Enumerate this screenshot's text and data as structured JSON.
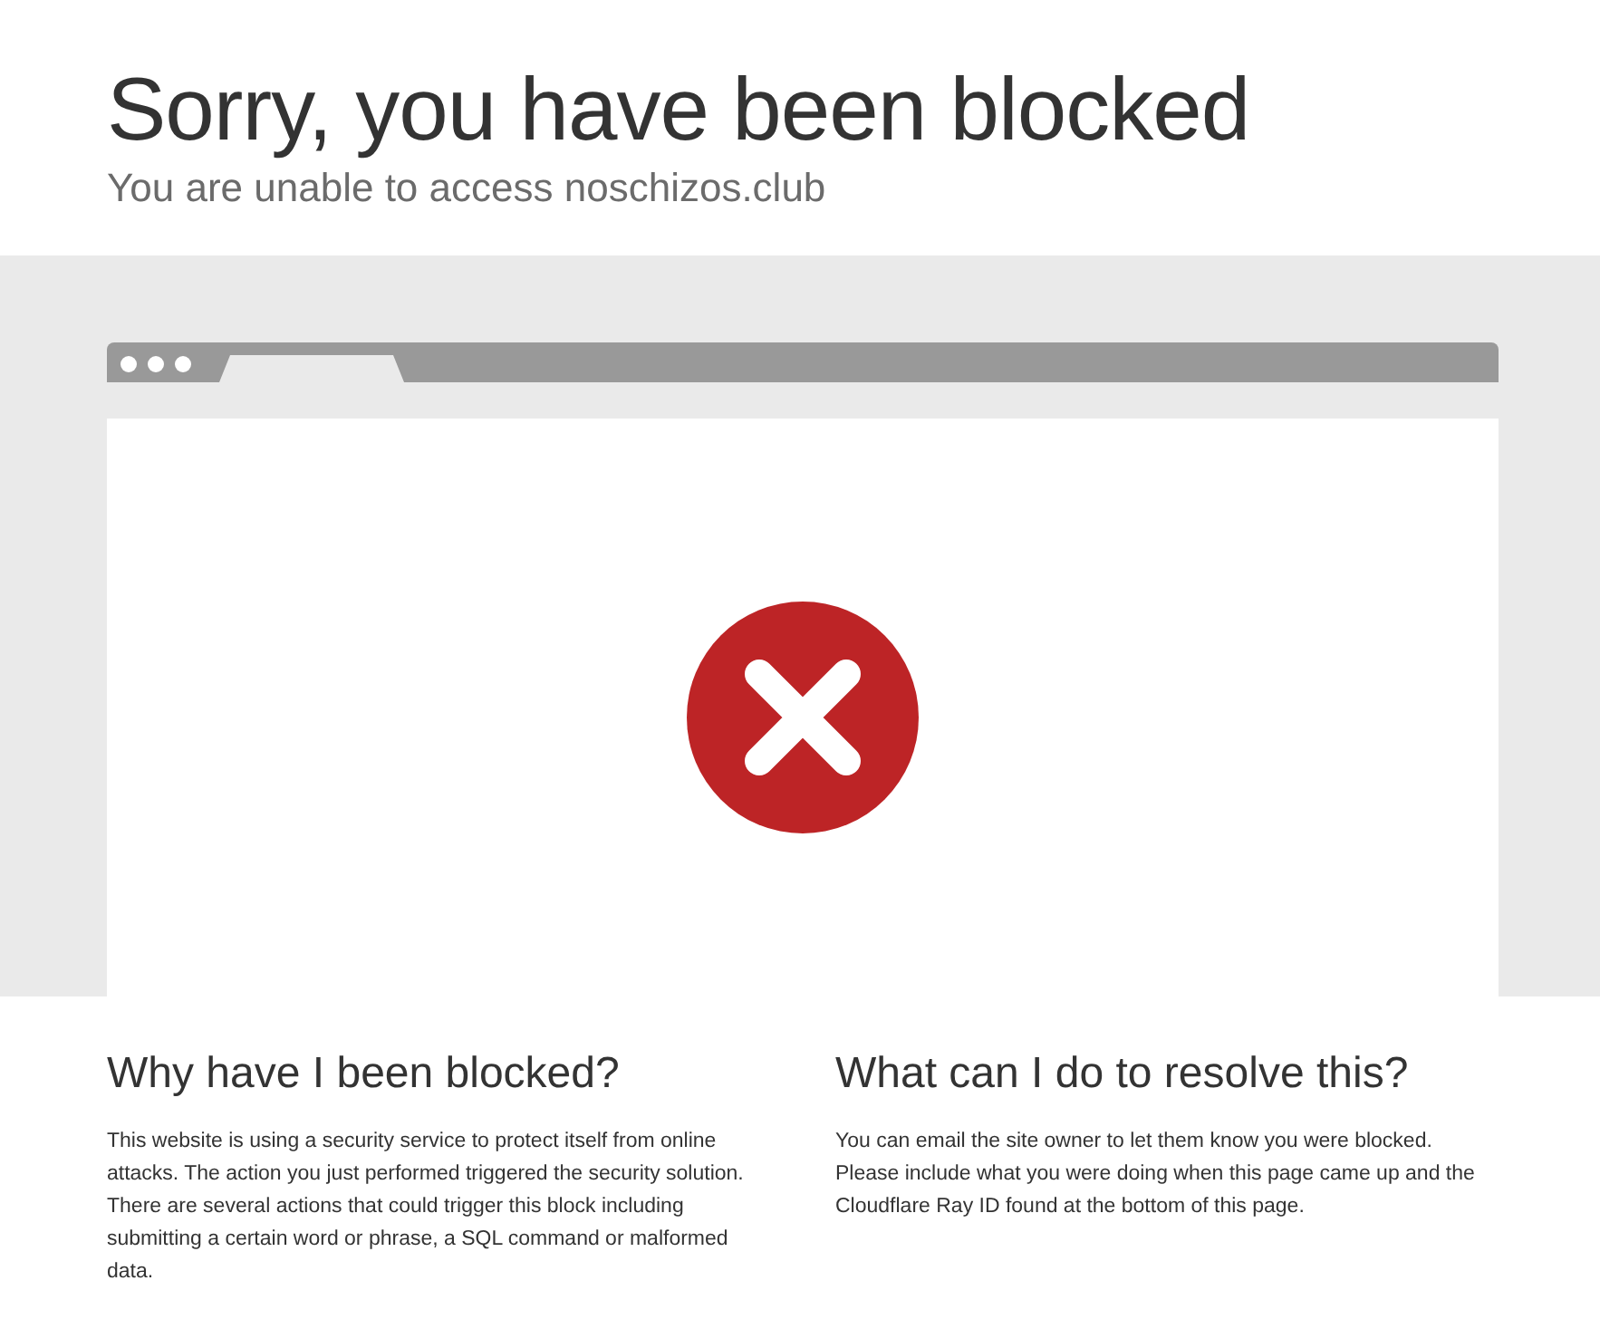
{
  "header": {
    "title": "Sorry, you have been blocked",
    "subtitle": "You are unable to access noschizos.club"
  },
  "sections": [
    {
      "heading": "Why have I been blocked?",
      "body": "This website is using a security service to protect itself from online attacks. The action you just performed triggered the security solution. There are several actions that could trigger this block including submitting a certain word or phrase, a SQL command or malformed data."
    },
    {
      "heading": "What can I do to resolve this?",
      "body": "You can email the site owner to let them know you were blocked. Please include what you were doing when this page came up and the Cloudflare Ray ID found at the bottom of this page."
    }
  ]
}
